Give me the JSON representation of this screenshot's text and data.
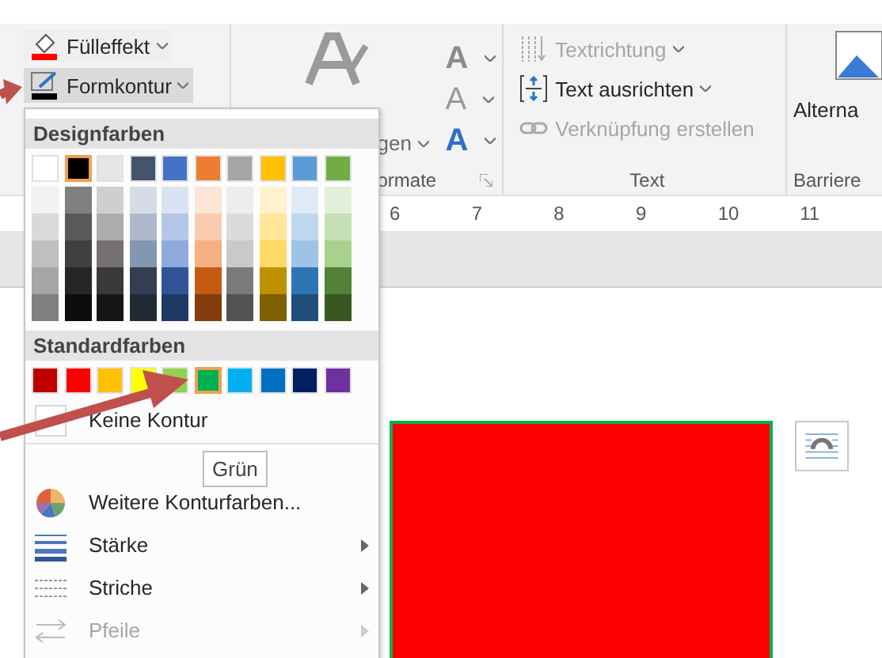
{
  "ribbon": {
    "shape_group": {
      "items": [
        {
          "label": "Fülleffekt",
          "kind": "fill",
          "highlighted": false
        },
        {
          "label": "Formkontur",
          "kind": "outline",
          "highlighted": true
        }
      ]
    },
    "wordart_group": {
      "fragment": "gen",
      "label": "ormate",
      "styles": [
        {
          "glyph": "A",
          "kind": "fill"
        },
        {
          "glyph": "A",
          "kind": "outline"
        },
        {
          "glyph": "A",
          "kind": "effects"
        }
      ]
    },
    "text_group": {
      "items": [
        {
          "label": "Textrichtung",
          "kind": "direction",
          "disabled": true,
          "dropdown": true
        },
        {
          "label": "Text ausrichten",
          "kind": "align",
          "disabled": false,
          "dropdown": true
        },
        {
          "label": "Verknüpfung erstellen",
          "kind": "link",
          "disabled": true,
          "dropdown": false
        }
      ],
      "label": "Text"
    },
    "accessibility_group": {
      "button": "Alterna",
      "label": "Barriere"
    }
  },
  "ruler": [
    "6",
    "7",
    "8",
    "9",
    "10",
    "11"
  ],
  "outline_menu": {
    "theme_header": "Designfarben",
    "theme_colors": [
      {
        "color": "#ffffff",
        "selected": false,
        "shades": [
          {
            "color": "#f2f2f2"
          },
          {
            "color": "#d9d9d9"
          },
          {
            "color": "#bfbfbf"
          },
          {
            "color": "#a6a6a6"
          },
          {
            "color": "#808080"
          }
        ]
      },
      {
        "color": "#000000",
        "selected": true,
        "shades": [
          {
            "color": "#7f7f7f"
          },
          {
            "color": "#595959"
          },
          {
            "color": "#404040"
          },
          {
            "color": "#262626"
          },
          {
            "color": "#0d0d0d"
          }
        ]
      },
      {
        "color": "#e7e6e6",
        "selected": false,
        "shades": [
          {
            "color": "#d0cece"
          },
          {
            "color": "#aeabab"
          },
          {
            "color": "#757171"
          },
          {
            "color": "#3b3838"
          },
          {
            "color": "#171616"
          }
        ]
      },
      {
        "color": "#44546a",
        "selected": false,
        "shades": [
          {
            "color": "#d6dce5"
          },
          {
            "color": "#adb9ca"
          },
          {
            "color": "#8497b0"
          },
          {
            "color": "#333f50"
          },
          {
            "color": "#222a35"
          }
        ]
      },
      {
        "color": "#4472c4",
        "selected": false,
        "shades": [
          {
            "color": "#dae3f3"
          },
          {
            "color": "#b4c7e7"
          },
          {
            "color": "#8faadc"
          },
          {
            "color": "#2f5597"
          },
          {
            "color": "#203864"
          }
        ]
      },
      {
        "color": "#ed7d31",
        "selected": false,
        "shades": [
          {
            "color": "#fbe5d6"
          },
          {
            "color": "#f8cbad"
          },
          {
            "color": "#f4b183"
          },
          {
            "color": "#c55a11"
          },
          {
            "color": "#843c0c"
          }
        ]
      },
      {
        "color": "#a5a5a5",
        "selected": false,
        "shades": [
          {
            "color": "#ededed"
          },
          {
            "color": "#dbdbdb"
          },
          {
            "color": "#c9c9c9"
          },
          {
            "color": "#7b7b7b"
          },
          {
            "color": "#525252"
          }
        ]
      },
      {
        "color": "#ffc000",
        "selected": false,
        "shades": [
          {
            "color": "#fff2cc"
          },
          {
            "color": "#ffe699"
          },
          {
            "color": "#ffd966"
          },
          {
            "color": "#bf9000"
          },
          {
            "color": "#7f6000"
          }
        ]
      },
      {
        "color": "#5b9bd5",
        "selected": false,
        "shades": [
          {
            "color": "#deebf7"
          },
          {
            "color": "#bdd7ee"
          },
          {
            "color": "#9dc3e6"
          },
          {
            "color": "#2e75b6"
          },
          {
            "color": "#1f4e79"
          }
        ]
      },
      {
        "color": "#70ad47",
        "selected": false,
        "shades": [
          {
            "color": "#e2f0d9"
          },
          {
            "color": "#c5e0b4"
          },
          {
            "color": "#a9d18e"
          },
          {
            "color": "#548235"
          },
          {
            "color": "#385723"
          }
        ]
      }
    ],
    "standard_header": "Standardfarben",
    "standard_colors": [
      {
        "color": "#c00000",
        "selected": false
      },
      {
        "color": "#ff0000",
        "selected": false
      },
      {
        "color": "#ffc000",
        "selected": false
      },
      {
        "color": "#ffff00",
        "selected": false
      },
      {
        "color": "#92d050",
        "selected": false
      },
      {
        "color": "#00b050",
        "selected": true
      },
      {
        "color": "#00b0f0",
        "selected": false
      },
      {
        "color": "#0070c0",
        "selected": false
      },
      {
        "color": "#002060",
        "selected": false
      },
      {
        "color": "#7030a0",
        "selected": false
      }
    ],
    "items": [
      {
        "label": "Keine Kontur",
        "kind": "none",
        "submenu": false,
        "disabled": false
      },
      {
        "label": "Weitere Konturfarben...",
        "kind": "more",
        "submenu": false,
        "disabled": false
      },
      {
        "label": "Stärke",
        "kind": "weight",
        "submenu": true,
        "disabled": false
      },
      {
        "label": "Striche",
        "kind": "dashes",
        "submenu": true,
        "disabled": false
      },
      {
        "label": "Pfeile",
        "kind": "arrows",
        "submenu": true,
        "disabled": true
      }
    ],
    "tooltip": "Grün"
  }
}
